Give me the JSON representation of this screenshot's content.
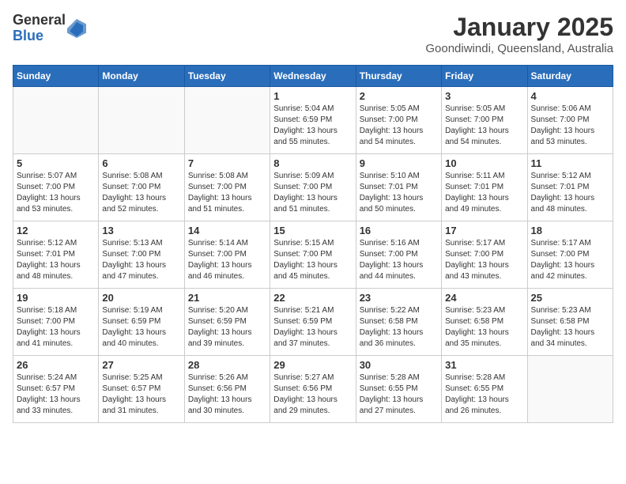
{
  "logo": {
    "general": "General",
    "blue": "Blue"
  },
  "title": "January 2025",
  "subtitle": "Goondiwindi, Queensland, Australia",
  "weekdays": [
    "Sunday",
    "Monday",
    "Tuesday",
    "Wednesday",
    "Thursday",
    "Friday",
    "Saturday"
  ],
  "weeks": [
    [
      {
        "day": "",
        "info": ""
      },
      {
        "day": "",
        "info": ""
      },
      {
        "day": "",
        "info": ""
      },
      {
        "day": "1",
        "info": "Sunrise: 5:04 AM\nSunset: 6:59 PM\nDaylight: 13 hours\nand 55 minutes."
      },
      {
        "day": "2",
        "info": "Sunrise: 5:05 AM\nSunset: 7:00 PM\nDaylight: 13 hours\nand 54 minutes."
      },
      {
        "day": "3",
        "info": "Sunrise: 5:05 AM\nSunset: 7:00 PM\nDaylight: 13 hours\nand 54 minutes."
      },
      {
        "day": "4",
        "info": "Sunrise: 5:06 AM\nSunset: 7:00 PM\nDaylight: 13 hours\nand 53 minutes."
      }
    ],
    [
      {
        "day": "5",
        "info": "Sunrise: 5:07 AM\nSunset: 7:00 PM\nDaylight: 13 hours\nand 53 minutes."
      },
      {
        "day": "6",
        "info": "Sunrise: 5:08 AM\nSunset: 7:00 PM\nDaylight: 13 hours\nand 52 minutes."
      },
      {
        "day": "7",
        "info": "Sunrise: 5:08 AM\nSunset: 7:00 PM\nDaylight: 13 hours\nand 51 minutes."
      },
      {
        "day": "8",
        "info": "Sunrise: 5:09 AM\nSunset: 7:00 PM\nDaylight: 13 hours\nand 51 minutes."
      },
      {
        "day": "9",
        "info": "Sunrise: 5:10 AM\nSunset: 7:01 PM\nDaylight: 13 hours\nand 50 minutes."
      },
      {
        "day": "10",
        "info": "Sunrise: 5:11 AM\nSunset: 7:01 PM\nDaylight: 13 hours\nand 49 minutes."
      },
      {
        "day": "11",
        "info": "Sunrise: 5:12 AM\nSunset: 7:01 PM\nDaylight: 13 hours\nand 48 minutes."
      }
    ],
    [
      {
        "day": "12",
        "info": "Sunrise: 5:12 AM\nSunset: 7:01 PM\nDaylight: 13 hours\nand 48 minutes."
      },
      {
        "day": "13",
        "info": "Sunrise: 5:13 AM\nSunset: 7:00 PM\nDaylight: 13 hours\nand 47 minutes."
      },
      {
        "day": "14",
        "info": "Sunrise: 5:14 AM\nSunset: 7:00 PM\nDaylight: 13 hours\nand 46 minutes."
      },
      {
        "day": "15",
        "info": "Sunrise: 5:15 AM\nSunset: 7:00 PM\nDaylight: 13 hours\nand 45 minutes."
      },
      {
        "day": "16",
        "info": "Sunrise: 5:16 AM\nSunset: 7:00 PM\nDaylight: 13 hours\nand 44 minutes."
      },
      {
        "day": "17",
        "info": "Sunrise: 5:17 AM\nSunset: 7:00 PM\nDaylight: 13 hours\nand 43 minutes."
      },
      {
        "day": "18",
        "info": "Sunrise: 5:17 AM\nSunset: 7:00 PM\nDaylight: 13 hours\nand 42 minutes."
      }
    ],
    [
      {
        "day": "19",
        "info": "Sunrise: 5:18 AM\nSunset: 7:00 PM\nDaylight: 13 hours\nand 41 minutes."
      },
      {
        "day": "20",
        "info": "Sunrise: 5:19 AM\nSunset: 6:59 PM\nDaylight: 13 hours\nand 40 minutes."
      },
      {
        "day": "21",
        "info": "Sunrise: 5:20 AM\nSunset: 6:59 PM\nDaylight: 13 hours\nand 39 minutes."
      },
      {
        "day": "22",
        "info": "Sunrise: 5:21 AM\nSunset: 6:59 PM\nDaylight: 13 hours\nand 37 minutes."
      },
      {
        "day": "23",
        "info": "Sunrise: 5:22 AM\nSunset: 6:58 PM\nDaylight: 13 hours\nand 36 minutes."
      },
      {
        "day": "24",
        "info": "Sunrise: 5:23 AM\nSunset: 6:58 PM\nDaylight: 13 hours\nand 35 minutes."
      },
      {
        "day": "25",
        "info": "Sunrise: 5:23 AM\nSunset: 6:58 PM\nDaylight: 13 hours\nand 34 minutes."
      }
    ],
    [
      {
        "day": "26",
        "info": "Sunrise: 5:24 AM\nSunset: 6:57 PM\nDaylight: 13 hours\nand 33 minutes."
      },
      {
        "day": "27",
        "info": "Sunrise: 5:25 AM\nSunset: 6:57 PM\nDaylight: 13 hours\nand 31 minutes."
      },
      {
        "day": "28",
        "info": "Sunrise: 5:26 AM\nSunset: 6:56 PM\nDaylight: 13 hours\nand 30 minutes."
      },
      {
        "day": "29",
        "info": "Sunrise: 5:27 AM\nSunset: 6:56 PM\nDaylight: 13 hours\nand 29 minutes."
      },
      {
        "day": "30",
        "info": "Sunrise: 5:28 AM\nSunset: 6:55 PM\nDaylight: 13 hours\nand 27 minutes."
      },
      {
        "day": "31",
        "info": "Sunrise: 5:28 AM\nSunset: 6:55 PM\nDaylight: 13 hours\nand 26 minutes."
      },
      {
        "day": "",
        "info": ""
      }
    ]
  ]
}
